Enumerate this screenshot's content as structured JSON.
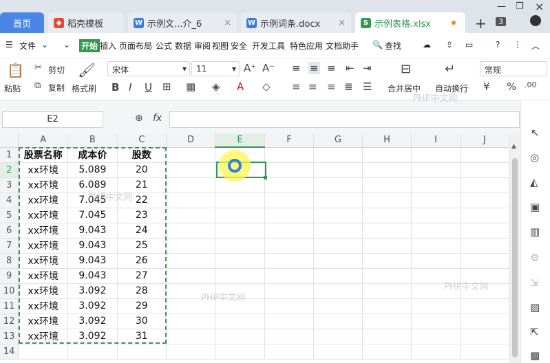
{
  "tabs": {
    "home": "首页",
    "t1": "稻壳模板",
    "t2": "示例文...介_6",
    "t3": "示例词条.docx",
    "t4": "示例表格.xlsx",
    "count": "3"
  },
  "menu": {
    "file": "文件",
    "items": [
      "开始",
      "插入",
      "页面布局",
      "公式",
      "数据",
      "审阅",
      "视图",
      "安全",
      "开发工具",
      "特色应用",
      "文档助手"
    ],
    "search": "查找"
  },
  "ribbon": {
    "paste": "粘贴",
    "cut": "剪切",
    "copy": "复制",
    "format_painter": "格式刷",
    "font": "宋体",
    "size": "11",
    "merge": "合并居中",
    "wrap": "自动换行",
    "number_format": "常规"
  },
  "formula": {
    "name_box": "E2",
    "fx": "fx"
  },
  "columns": [
    "A",
    "B",
    "C",
    "D",
    "E",
    "F",
    "G",
    "H",
    "I",
    "J"
  ],
  "headers": [
    "股票名称",
    "成本价",
    "股数"
  ],
  "rows": [
    [
      "xx环境",
      "5.089",
      "20"
    ],
    [
      "xx环境",
      "6.089",
      "21"
    ],
    [
      "xx环境",
      "7.045",
      "22"
    ],
    [
      "xx环境",
      "7.045",
      "23"
    ],
    [
      "xx环境",
      "9.043",
      "24"
    ],
    [
      "xx环境",
      "9.043",
      "25"
    ],
    [
      "xx环境",
      "9.043",
      "26"
    ],
    [
      "xx环境",
      "9.043",
      "27"
    ],
    [
      "xx环境",
      "3.092",
      "28"
    ],
    [
      "xx环境",
      "3.092",
      "29"
    ],
    [
      "xx环境",
      "3.092",
      "30"
    ],
    [
      "xx环境",
      "3.092",
      "31"
    ]
  ],
  "row_numbers": [
    "1",
    "2",
    "3",
    "4",
    "5",
    "6",
    "7",
    "8",
    "9",
    "10",
    "11",
    "12",
    "13",
    "14"
  ],
  "watermark": "PHP中文网",
  "colors": {
    "accent": "#2d9c4e",
    "home_tab": "#4a86e8"
  }
}
